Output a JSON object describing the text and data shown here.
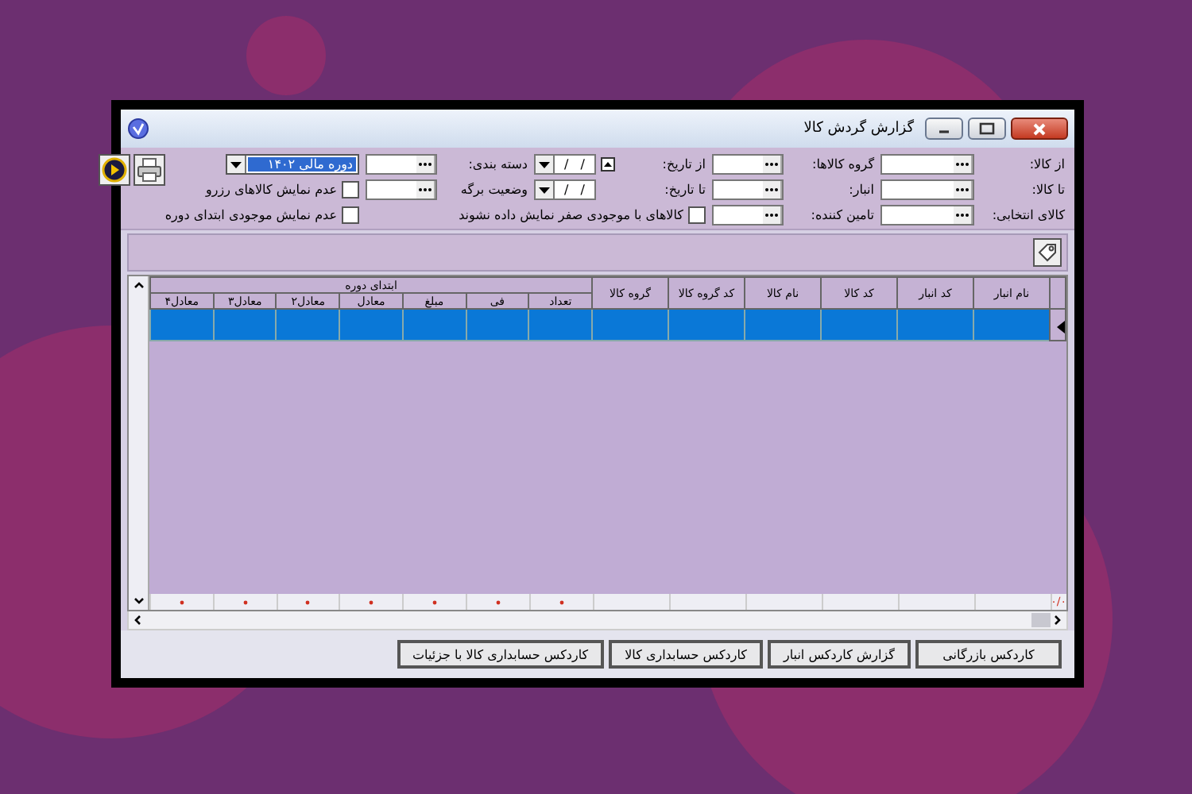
{
  "window": {
    "title": "گزارش گردش کالا"
  },
  "filters": [
    [
      {
        "kind": "field",
        "label": "از کالا:"
      },
      {
        "kind": "field",
        "label": "گروه کالاها:"
      },
      {
        "kind": "date",
        "label": "از تاریخ:",
        "value": "/   /",
        "spin": true
      },
      {
        "kind": "field",
        "label": "دسته بندی:"
      },
      {
        "kind": "combo",
        "value": "دوره مالی ۱۴۰۲"
      }
    ],
    [
      {
        "kind": "field",
        "label": "تا کالا:"
      },
      {
        "kind": "field",
        "label": "انبار:"
      },
      {
        "kind": "date",
        "label": "تا تاریخ:",
        "value": "/   /"
      },
      {
        "kind": "field",
        "label": "وضعیت برگه"
      },
      {
        "kind": "checkbox",
        "label": "عدم نمایش کالاهای رزرو",
        "checked": false
      }
    ],
    [
      {
        "kind": "field",
        "label": "کالای انتخابی:"
      },
      {
        "kind": "field",
        "label": "تامین کننده:"
      },
      {
        "kind": "checkbox",
        "label": "کالاهای با موجودی صفر نمایش داده نشوند",
        "checked": false
      },
      {
        "kind": "checkbox",
        "label": "عدم نمایش موجودی ابتدای دوره",
        "checked": false
      }
    ]
  ],
  "grid": {
    "columns": [
      "نام انبار",
      "کد انبار",
      "کد کالا",
      "نام کالا",
      "کد گروه کالا",
      "گروه کالا"
    ],
    "group_header": "ابتدای دوره",
    "group_columns": [
      "تعداد",
      "فی",
      "مبلغ",
      "معادل",
      "معادل۲",
      "معادل۳",
      "معادل۴"
    ],
    "rows": [
      {
        "selected": true
      }
    ],
    "footer_total": "٠/٠"
  },
  "buttons": [
    "کاردکس بازرگانی",
    "گزارش کاردکس انبار",
    "کاردکس حسابداری کالا",
    "کاردکس حسابداری کالا با جزئیات"
  ]
}
